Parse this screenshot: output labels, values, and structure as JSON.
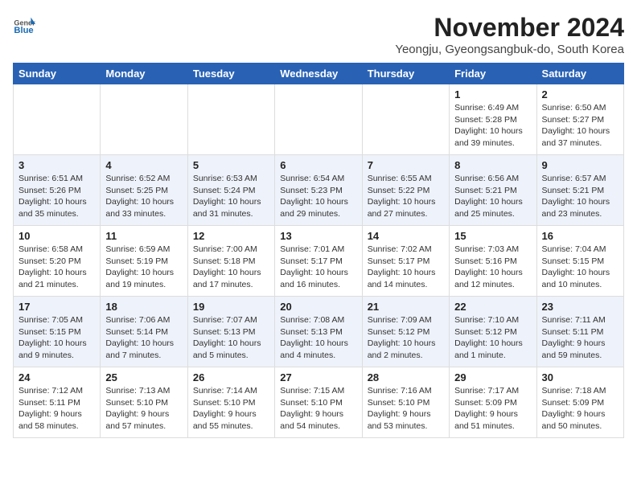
{
  "header": {
    "logo_general": "General",
    "logo_blue": "Blue",
    "month_title": "November 2024",
    "location": "Yeongju, Gyeongsangbuk-do, South Korea"
  },
  "days_of_week": [
    "Sunday",
    "Monday",
    "Tuesday",
    "Wednesday",
    "Thursday",
    "Friday",
    "Saturday"
  ],
  "weeks": [
    {
      "days": [
        {
          "num": "",
          "info": ""
        },
        {
          "num": "",
          "info": ""
        },
        {
          "num": "",
          "info": ""
        },
        {
          "num": "",
          "info": ""
        },
        {
          "num": "",
          "info": ""
        },
        {
          "num": "1",
          "info": "Sunrise: 6:49 AM\nSunset: 5:28 PM\nDaylight: 10 hours\nand 39 minutes."
        },
        {
          "num": "2",
          "info": "Sunrise: 6:50 AM\nSunset: 5:27 PM\nDaylight: 10 hours\nand 37 minutes."
        }
      ]
    },
    {
      "days": [
        {
          "num": "3",
          "info": "Sunrise: 6:51 AM\nSunset: 5:26 PM\nDaylight: 10 hours\nand 35 minutes."
        },
        {
          "num": "4",
          "info": "Sunrise: 6:52 AM\nSunset: 5:25 PM\nDaylight: 10 hours\nand 33 minutes."
        },
        {
          "num": "5",
          "info": "Sunrise: 6:53 AM\nSunset: 5:24 PM\nDaylight: 10 hours\nand 31 minutes."
        },
        {
          "num": "6",
          "info": "Sunrise: 6:54 AM\nSunset: 5:23 PM\nDaylight: 10 hours\nand 29 minutes."
        },
        {
          "num": "7",
          "info": "Sunrise: 6:55 AM\nSunset: 5:22 PM\nDaylight: 10 hours\nand 27 minutes."
        },
        {
          "num": "8",
          "info": "Sunrise: 6:56 AM\nSunset: 5:21 PM\nDaylight: 10 hours\nand 25 minutes."
        },
        {
          "num": "9",
          "info": "Sunrise: 6:57 AM\nSunset: 5:21 PM\nDaylight: 10 hours\nand 23 minutes."
        }
      ]
    },
    {
      "days": [
        {
          "num": "10",
          "info": "Sunrise: 6:58 AM\nSunset: 5:20 PM\nDaylight: 10 hours\nand 21 minutes."
        },
        {
          "num": "11",
          "info": "Sunrise: 6:59 AM\nSunset: 5:19 PM\nDaylight: 10 hours\nand 19 minutes."
        },
        {
          "num": "12",
          "info": "Sunrise: 7:00 AM\nSunset: 5:18 PM\nDaylight: 10 hours\nand 17 minutes."
        },
        {
          "num": "13",
          "info": "Sunrise: 7:01 AM\nSunset: 5:17 PM\nDaylight: 10 hours\nand 16 minutes."
        },
        {
          "num": "14",
          "info": "Sunrise: 7:02 AM\nSunset: 5:17 PM\nDaylight: 10 hours\nand 14 minutes."
        },
        {
          "num": "15",
          "info": "Sunrise: 7:03 AM\nSunset: 5:16 PM\nDaylight: 10 hours\nand 12 minutes."
        },
        {
          "num": "16",
          "info": "Sunrise: 7:04 AM\nSunset: 5:15 PM\nDaylight: 10 hours\nand 10 minutes."
        }
      ]
    },
    {
      "days": [
        {
          "num": "17",
          "info": "Sunrise: 7:05 AM\nSunset: 5:15 PM\nDaylight: 10 hours\nand 9 minutes."
        },
        {
          "num": "18",
          "info": "Sunrise: 7:06 AM\nSunset: 5:14 PM\nDaylight: 10 hours\nand 7 minutes."
        },
        {
          "num": "19",
          "info": "Sunrise: 7:07 AM\nSunset: 5:13 PM\nDaylight: 10 hours\nand 5 minutes."
        },
        {
          "num": "20",
          "info": "Sunrise: 7:08 AM\nSunset: 5:13 PM\nDaylight: 10 hours\nand 4 minutes."
        },
        {
          "num": "21",
          "info": "Sunrise: 7:09 AM\nSunset: 5:12 PM\nDaylight: 10 hours\nand 2 minutes."
        },
        {
          "num": "22",
          "info": "Sunrise: 7:10 AM\nSunset: 5:12 PM\nDaylight: 10 hours\nand 1 minute."
        },
        {
          "num": "23",
          "info": "Sunrise: 7:11 AM\nSunset: 5:11 PM\nDaylight: 9 hours\nand 59 minutes."
        }
      ]
    },
    {
      "days": [
        {
          "num": "24",
          "info": "Sunrise: 7:12 AM\nSunset: 5:11 PM\nDaylight: 9 hours\nand 58 minutes."
        },
        {
          "num": "25",
          "info": "Sunrise: 7:13 AM\nSunset: 5:10 PM\nDaylight: 9 hours\nand 57 minutes."
        },
        {
          "num": "26",
          "info": "Sunrise: 7:14 AM\nSunset: 5:10 PM\nDaylight: 9 hours\nand 55 minutes."
        },
        {
          "num": "27",
          "info": "Sunrise: 7:15 AM\nSunset: 5:10 PM\nDaylight: 9 hours\nand 54 minutes."
        },
        {
          "num": "28",
          "info": "Sunrise: 7:16 AM\nSunset: 5:10 PM\nDaylight: 9 hours\nand 53 minutes."
        },
        {
          "num": "29",
          "info": "Sunrise: 7:17 AM\nSunset: 5:09 PM\nDaylight: 9 hours\nand 51 minutes."
        },
        {
          "num": "30",
          "info": "Sunrise: 7:18 AM\nSunset: 5:09 PM\nDaylight: 9 hours\nand 50 minutes."
        }
      ]
    }
  ]
}
